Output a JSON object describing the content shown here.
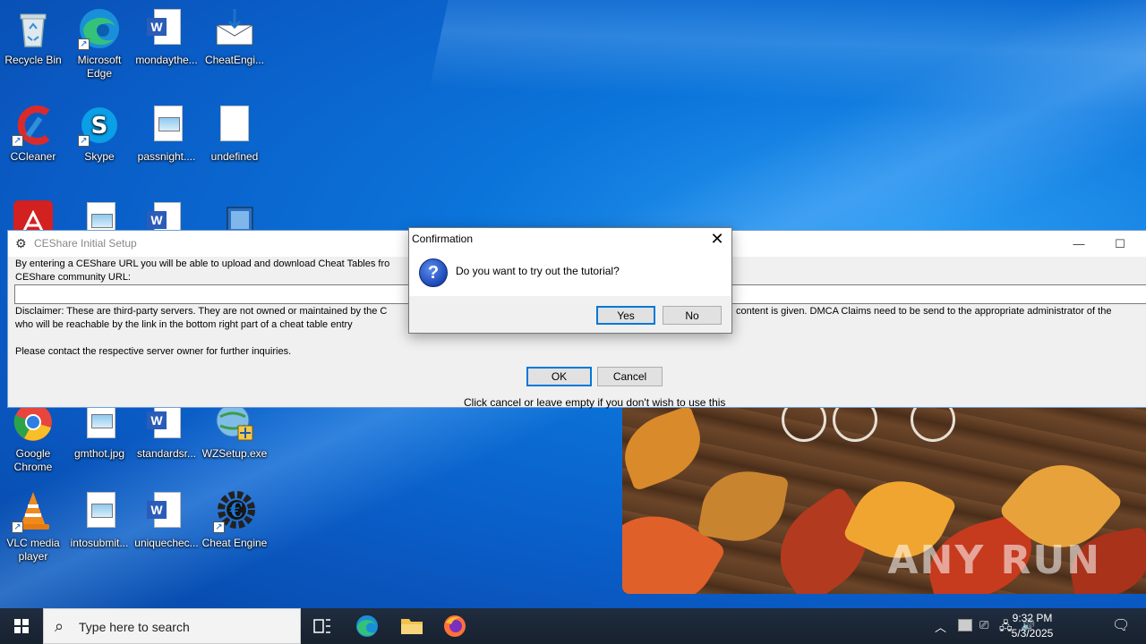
{
  "desktop": {
    "icons": [
      {
        "id": "recycle-bin",
        "label": "Recycle Bin"
      },
      {
        "id": "microsoft-edge",
        "label": "Microsoft Edge"
      },
      {
        "id": "mondaythe",
        "label": "mondaythe..."
      },
      {
        "id": "cheatengine-setup",
        "label": "CheatEngi..."
      },
      {
        "id": "ccleaner",
        "label": "CCleaner"
      },
      {
        "id": "skype",
        "label": "Skype"
      },
      {
        "id": "passnight",
        "label": "passnight...."
      },
      {
        "id": "undefined",
        "label": "undefined"
      },
      {
        "id": "google-chrome",
        "label": "Google Chrome"
      },
      {
        "id": "gmthot",
        "label": "gmthot.jpg"
      },
      {
        "id": "standardsr",
        "label": "standardsr..."
      },
      {
        "id": "wzsetup",
        "label": "WZSetup.exe"
      },
      {
        "id": "vlc",
        "label": "VLC media player"
      },
      {
        "id": "intosubmit",
        "label": "intosubmit..."
      },
      {
        "id": "uniquechec",
        "label": "uniquechec..."
      },
      {
        "id": "cheat-engine",
        "label": "Cheat Engine"
      }
    ],
    "watermark": "ANY RUN"
  },
  "ceshare": {
    "title": "CEShare Initial Setup",
    "intro": "By entering a CEShare URL you will be able to upload and download Cheat Tables fro",
    "url_label": "CEShare community URL:",
    "url_value": "",
    "disclaimer_left": "Disclaimer: These are third-party servers. They are not owned or maintained by the C",
    "disclaimer_right": "content is given.  DMCA Claims need to be send to the appropriate administrator of the",
    "disclaimer_line2": "who will be reachable by the link in the bottom right part of a cheat table entry",
    "contact": "Please contact the respective server owner for further inquiries.",
    "ok_label": "OK",
    "cancel_label": "Cancel",
    "hint": "Click cancel or leave empty if you don't wish to use this"
  },
  "confirm": {
    "title": "Confirmation",
    "message": "Do you want to try out the tutorial?",
    "yes_label": "Yes",
    "no_label": "No"
  },
  "taskbar": {
    "search_placeholder": "Type here to search",
    "time": "9:32 PM",
    "date": "5/3/2025"
  },
  "colors": {
    "accent": "#0078d7",
    "desktop": "#0b74da",
    "taskbar": "#1c2a3a"
  }
}
